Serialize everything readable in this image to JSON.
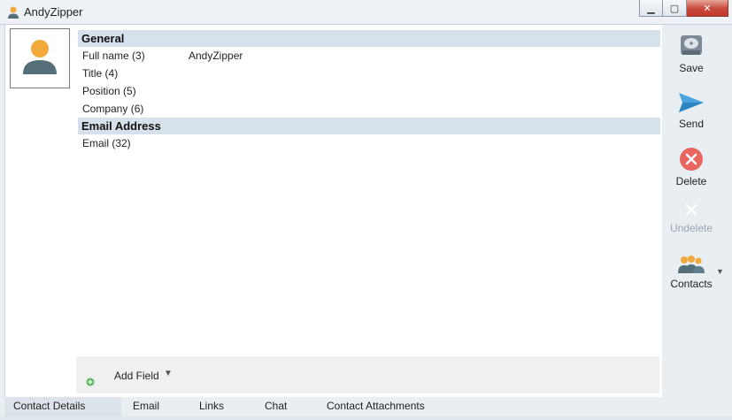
{
  "window": {
    "title": "AndyZipper",
    "minimize_glyph": "▁",
    "maximize_glyph": "▢",
    "close_glyph": "✕"
  },
  "sections": [
    {
      "title": "General",
      "fields": [
        {
          "label": "Full name (3)",
          "value": "AndyZipper"
        },
        {
          "label": "Title (4)",
          "value": ""
        },
        {
          "label": "Position (5)",
          "value": ""
        },
        {
          "label": "Company (6)",
          "value": ""
        }
      ]
    },
    {
      "title": "Email Address",
      "fields": [
        {
          "label": "Email (32)",
          "value": ""
        }
      ]
    }
  ],
  "add_field": {
    "label": "Add Field",
    "arrow": "▼"
  },
  "toolbar": {
    "save": "Save",
    "send": "Send",
    "delete": "Delete",
    "undelete": "Undelete",
    "contacts": "Contacts",
    "contacts_arrow": "▼"
  },
  "tabs": [
    "Contact Details",
    "Email",
    "Links",
    "Chat",
    "Contact Attachments"
  ],
  "colors": {
    "section_header": "#d7e1eb",
    "avatar_head": "#f2a93b",
    "avatar_body": "#546e7a",
    "delete_red": "#e8665f",
    "send_blue": "#4aa3df"
  }
}
